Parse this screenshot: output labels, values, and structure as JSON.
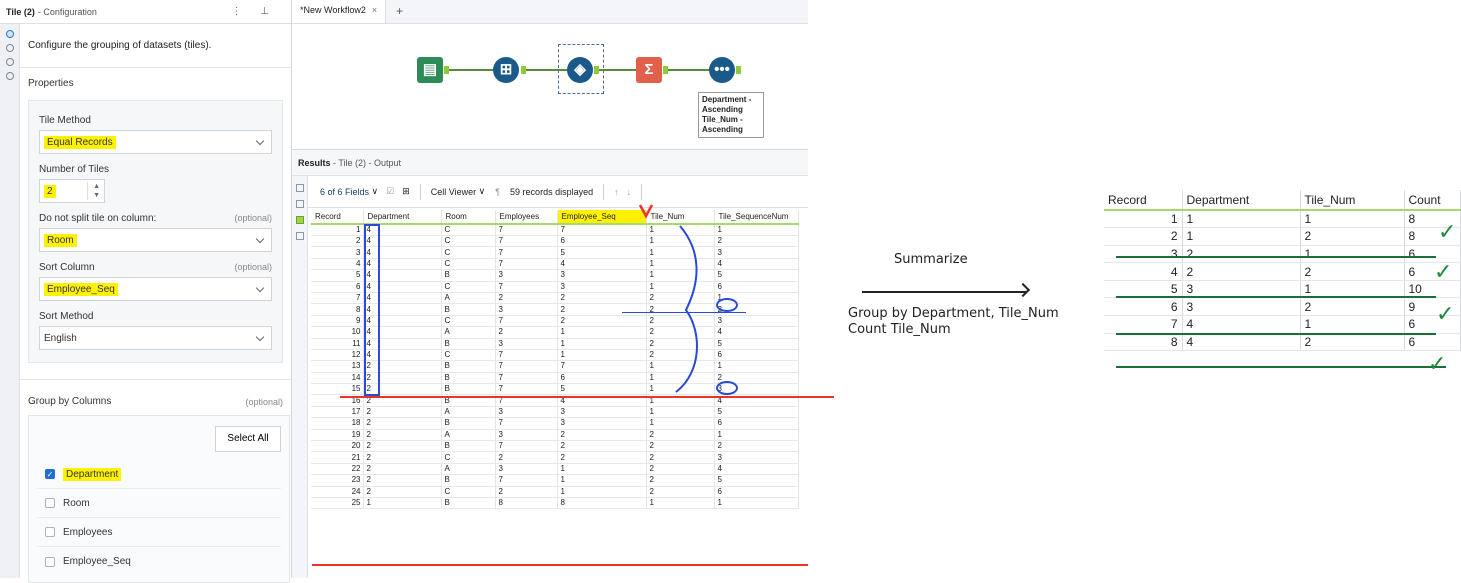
{
  "config": {
    "title": "Tile (2)",
    "subtitle": "- Configuration",
    "header_icons": "⋮  ⊥",
    "description": "Configure the grouping of datasets (tiles).",
    "properties_heading": "Properties",
    "tile_method_label": "Tile Method",
    "tile_method_value": "Equal Records",
    "num_tiles_label": "Number of Tiles",
    "num_tiles_value": "2",
    "nosplit_label": "Do not split tile on column:",
    "nosplit_optional": "(optional)",
    "nosplit_value": "Room",
    "sort_col_label": "Sort Column",
    "sort_col_optional": "(optional)",
    "sort_col_value": "Employee_Seq",
    "sort_method_label": "Sort Method",
    "sort_method_value": "English",
    "group_label": "Group by Columns",
    "group_optional": "(optional)",
    "select_all": "Select All",
    "group_items": [
      {
        "label": "Department",
        "checked": true
      },
      {
        "label": "Room",
        "checked": false
      },
      {
        "label": "Employees",
        "checked": false
      },
      {
        "label": "Employee_Seq",
        "checked": false
      }
    ]
  },
  "canvas": {
    "tab_label": "*New Workflow2",
    "tab_close": "×",
    "tab_add": "+",
    "sort_annotation": "Department -\nAscending\nTile_Num -\nAscending"
  },
  "results": {
    "title": "Results",
    "subtitle": "- Tile (2) - Output",
    "fields": "6 of 6 Fields",
    "viewer": "Cell Viewer",
    "records": "59 records displayed",
    "columns": [
      "Record",
      "Department",
      "Room",
      "Employees",
      "Employee_Seq",
      "Tile_Num",
      "Tile_SequenceNum"
    ],
    "rows": [
      [
        "1",
        "4",
        "C",
        "7",
        "7",
        "1",
        "1"
      ],
      [
        "2",
        "4",
        "C",
        "7",
        "6",
        "1",
        "2"
      ],
      [
        "3",
        "4",
        "C",
        "7",
        "5",
        "1",
        "3"
      ],
      [
        "4",
        "4",
        "C",
        "7",
        "4",
        "1",
        "4"
      ],
      [
        "5",
        "4",
        "B",
        "3",
        "3",
        "1",
        "5"
      ],
      [
        "6",
        "4",
        "C",
        "7",
        "3",
        "1",
        "6"
      ],
      [
        "7",
        "4",
        "A",
        "2",
        "2",
        "2",
        "1"
      ],
      [
        "8",
        "4",
        "B",
        "3",
        "2",
        "2",
        "2"
      ],
      [
        "9",
        "4",
        "C",
        "7",
        "2",
        "2",
        "3"
      ],
      [
        "10",
        "4",
        "A",
        "2",
        "1",
        "2",
        "4"
      ],
      [
        "11",
        "4",
        "B",
        "3",
        "1",
        "2",
        "5"
      ],
      [
        "12",
        "4",
        "C",
        "7",
        "1",
        "2",
        "6"
      ],
      [
        "13",
        "2",
        "B",
        "7",
        "7",
        "1",
        "1"
      ],
      [
        "14",
        "2",
        "B",
        "7",
        "6",
        "1",
        "2"
      ],
      [
        "15",
        "2",
        "B",
        "7",
        "5",
        "1",
        "3"
      ],
      [
        "16",
        "2",
        "B",
        "7",
        "4",
        "1",
        "4"
      ],
      [
        "17",
        "2",
        "A",
        "3",
        "3",
        "1",
        "5"
      ],
      [
        "18",
        "2",
        "B",
        "7",
        "3",
        "1",
        "6"
      ],
      [
        "19",
        "2",
        "A",
        "3",
        "2",
        "2",
        "1"
      ],
      [
        "20",
        "2",
        "B",
        "7",
        "2",
        "2",
        "2"
      ],
      [
        "21",
        "2",
        "C",
        "2",
        "2",
        "2",
        "3"
      ],
      [
        "22",
        "2",
        "A",
        "3",
        "1",
        "2",
        "4"
      ],
      [
        "23",
        "2",
        "B",
        "7",
        "1",
        "2",
        "5"
      ],
      [
        "24",
        "2",
        "C",
        "2",
        "1",
        "2",
        "6"
      ],
      [
        "25",
        "1",
        "B",
        "8",
        "8",
        "1",
        "1"
      ]
    ]
  },
  "annotation": {
    "summarize": "Summarize",
    "group_line1": "Group by Department, Tile_Num",
    "group_line2": "Count Tile_Num"
  },
  "summary": {
    "columns": [
      "Record",
      "Department",
      "Tile_Num",
      "Count"
    ],
    "rows": [
      [
        "1",
        "1",
        "1",
        "8"
      ],
      [
        "2",
        "1",
        "2",
        "8"
      ],
      [
        "3",
        "2",
        "1",
        "6"
      ],
      [
        "4",
        "2",
        "2",
        "6"
      ],
      [
        "5",
        "3",
        "1",
        "10"
      ],
      [
        "6",
        "3",
        "2",
        "9"
      ],
      [
        "7",
        "4",
        "1",
        "6"
      ],
      [
        "8",
        "4",
        "2",
        "6"
      ]
    ]
  },
  "colors": {
    "highlight": "#fff200",
    "pen_red": "#e8342a",
    "pen_blue": "#2a4bd6",
    "check_green": "#1b8a3a",
    "header_underline": "#a8d86a"
  }
}
